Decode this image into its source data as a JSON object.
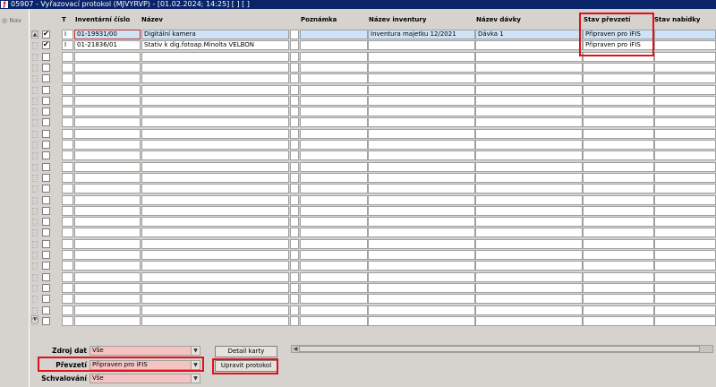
{
  "window": {
    "title": "05907 - Vyřazovací protokol (MJVYRVP) - [01.02.2024; 14:25]  [ ]  [ ]"
  },
  "sidebar": {
    "nav_label": "Nav"
  },
  "grid": {
    "headers": {
      "t": "T",
      "inv_cislo": "Inventární číslo",
      "nazev": "Název",
      "poznamka": "Poznámka",
      "nazev_inventury": "Název inventury",
      "nazev_davky": "Název dávky",
      "stav_prevzeti": "Stav převzetí",
      "stav_nabidky": "Stav nabídky"
    },
    "rows": [
      {
        "checked": true,
        "t": "I",
        "inv_cislo": "01-19931/00",
        "nazev": "Digitální kamera",
        "poznamka": "",
        "nazev_inventury": "Inventura majetku 12/2021",
        "nazev_davky": "Dávka 1",
        "stav_prevzeti": "Připraven pro iFIS",
        "stav_nabidky": ""
      },
      {
        "checked": true,
        "t": "I",
        "inv_cislo": "01-21836/01",
        "nazev": "Stativ k dig.fotoap.Minolta VELBON",
        "poznamka": "",
        "nazev_inventury": "",
        "nazev_davky": "",
        "stav_prevzeti": "Připraven pro iFIS",
        "stav_nabidky": ""
      }
    ],
    "empty_rows": 25
  },
  "filters": {
    "zdroj_dat": {
      "label": "Zdroj dat",
      "value": "Vše"
    },
    "prevzeti": {
      "label": "Převzetí",
      "value": "Připraven pro iFIS"
    },
    "schvalovani": {
      "label": "Schvalování",
      "value": "Vše"
    }
  },
  "buttons": {
    "detail_karty": "Detail karty",
    "upravit_protokol": "Upravit protokol"
  },
  "colors": {
    "highlight": "#e0101c",
    "titlebar": "#0a246a",
    "filter_bg": "#f6c3c3"
  }
}
